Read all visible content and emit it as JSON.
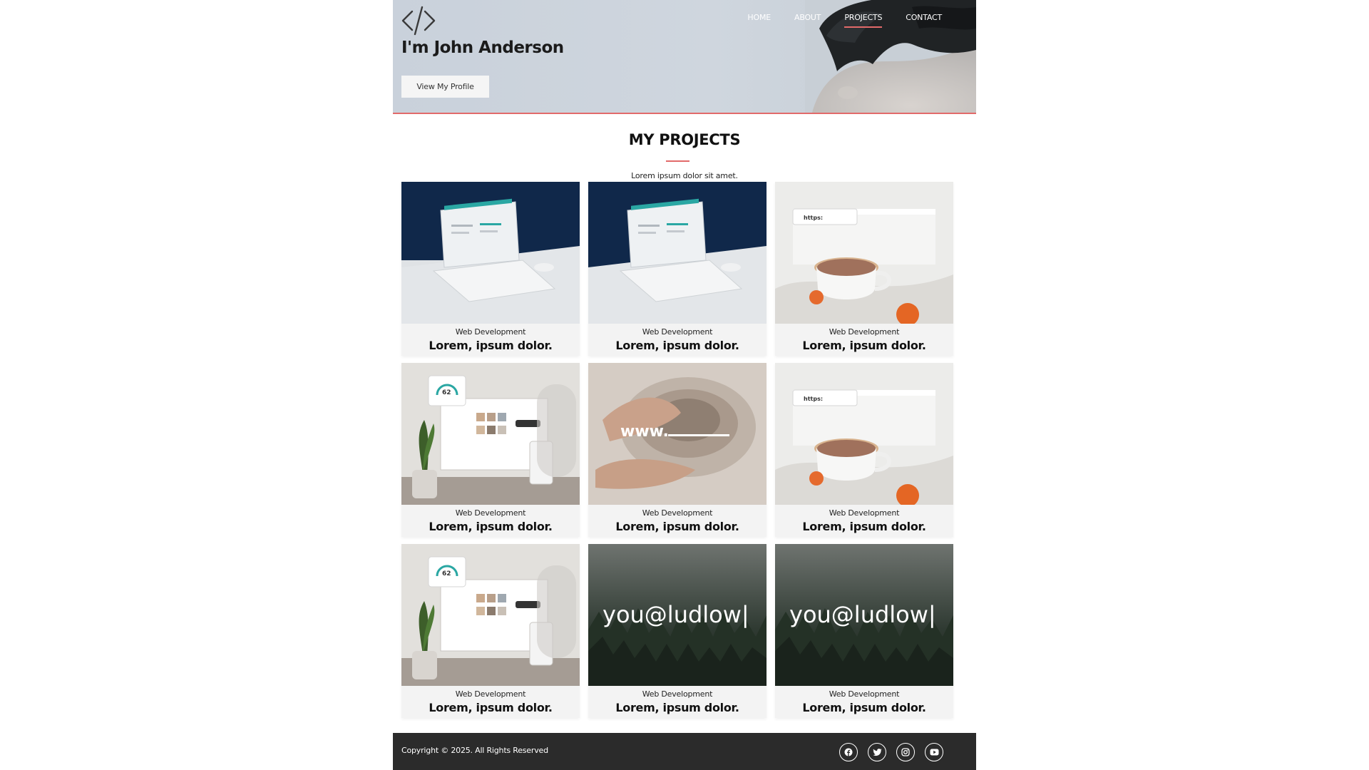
{
  "nav": {
    "items": [
      {
        "label": "HOME",
        "active": false
      },
      {
        "label": "ABOUT",
        "active": false
      },
      {
        "label": "PROJECTS",
        "active": true
      },
      {
        "label": "CONTACT",
        "active": false
      }
    ]
  },
  "hero": {
    "logo_icon": "code-brackets-icon",
    "title": "I'm John Anderson",
    "button_label": "View My Profile"
  },
  "projects": {
    "title": "MY PROJECTS",
    "subtitle": "Lorem ipsum dolor sit amet.",
    "cards": [
      {
        "category": "Web Development",
        "title": "Lorem, ipsum dolor.",
        "image": "laptop-dashboard"
      },
      {
        "category": "Web Development",
        "title": "Lorem, ipsum dolor.",
        "image": "laptop-dashboard"
      },
      {
        "category": "Web Development",
        "title": "Lorem, ipsum dolor.",
        "image": "coffee-browser",
        "image_text": "https:"
      },
      {
        "category": "Web Development",
        "title": "Lorem, ipsum dolor.",
        "image": "monitor-plant",
        "image_text": "62"
      },
      {
        "category": "Web Development",
        "title": "Lorem, ipsum dolor.",
        "image": "pottery-www",
        "image_text": "www."
      },
      {
        "category": "Web Development",
        "title": "Lorem, ipsum dolor.",
        "image": "coffee-browser",
        "image_text": "https:"
      },
      {
        "category": "Web Development",
        "title": "Lorem, ipsum dolor.",
        "image": "monitor-plant",
        "image_text": "62"
      },
      {
        "category": "Web Development",
        "title": "Lorem, ipsum dolor.",
        "image": "forest-email",
        "image_text": "you@ludlow|"
      },
      {
        "category": "Web Development",
        "title": "Lorem, ipsum dolor.",
        "image": "forest-email",
        "image_text": "you@ludlow|"
      }
    ]
  },
  "footer": {
    "copyright": "Copyright © 2025. All Rights Reserved",
    "socials": [
      "facebook-icon",
      "twitter-icon",
      "instagram-icon",
      "youtube-icon"
    ]
  },
  "colors": {
    "accent": "#e26a6a",
    "footer_bg": "#2b2b2b",
    "card_bg": "#f3f3f3"
  }
}
